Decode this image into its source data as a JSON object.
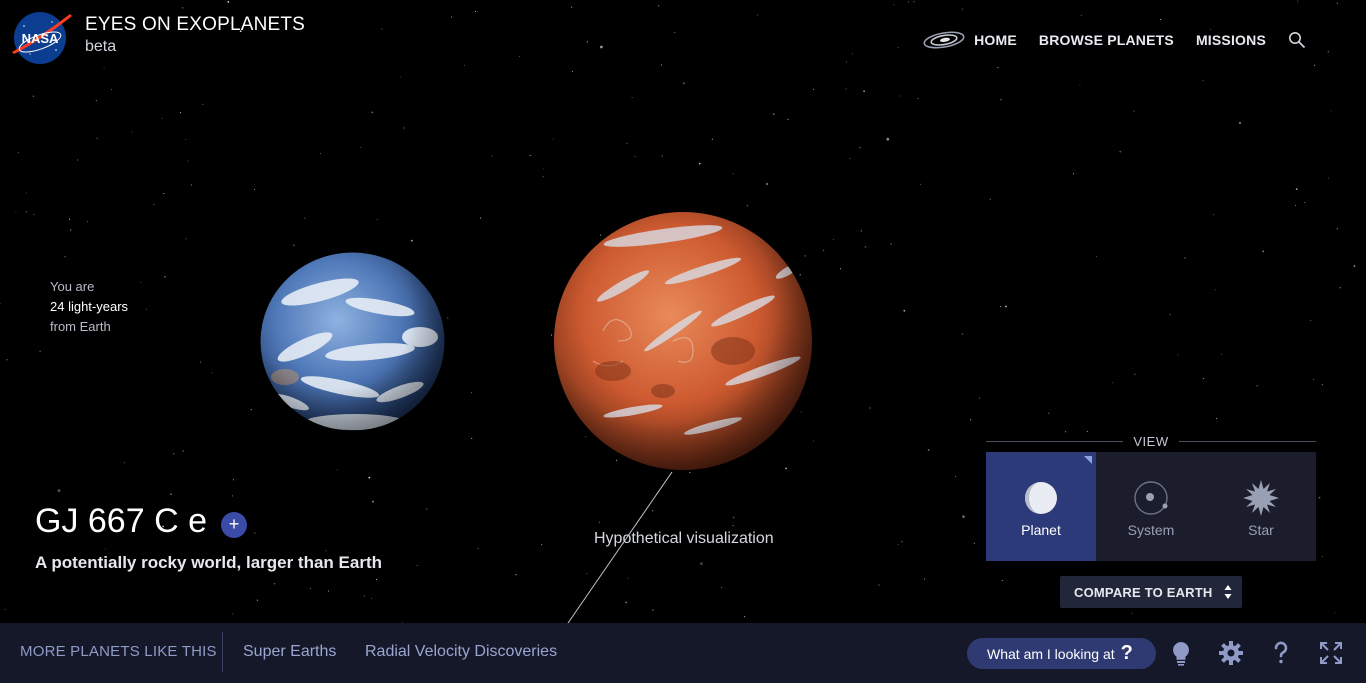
{
  "header": {
    "logo_text": "NASA",
    "title": "EYES ON EXOPLANETS",
    "subtitle": "beta",
    "nav": [
      {
        "label": "HOME"
      },
      {
        "label": "BROWSE PLANETS"
      },
      {
        "label": "MISSIONS"
      }
    ]
  },
  "distance": {
    "prefix": "You are",
    "value": "24 light-years",
    "suffix": "from Earth"
  },
  "planet": {
    "name": "GJ 667 C e",
    "add_symbol": "+",
    "description": "A potentially rocky world, larger than Earth",
    "visualization_note": "Hypothetical visualization"
  },
  "view": {
    "heading": "VIEW",
    "options": [
      {
        "label": "Planet",
        "icon": "planet-icon",
        "active": true
      },
      {
        "label": "System",
        "icon": "system-icon",
        "active": false
      },
      {
        "label": "Star",
        "icon": "star-icon",
        "active": false
      }
    ],
    "compare_label": "COMPARE TO EARTH"
  },
  "bottom_bar": {
    "more_label": "MORE PLANETS LIKE THIS",
    "categories": [
      {
        "label": "Super Earths"
      },
      {
        "label": "Radial Velocity Discoveries"
      }
    ],
    "looking_label": "What am I looking at",
    "looking_symbol": "?"
  },
  "colors": {
    "background": "#000000",
    "bar": "#141829",
    "panel": "#1b1d2c",
    "active": "#2c3a7a",
    "accent": "#3b4ba8",
    "nasa_blue": "#0b3d91",
    "nasa_red": "#fc3d21"
  }
}
